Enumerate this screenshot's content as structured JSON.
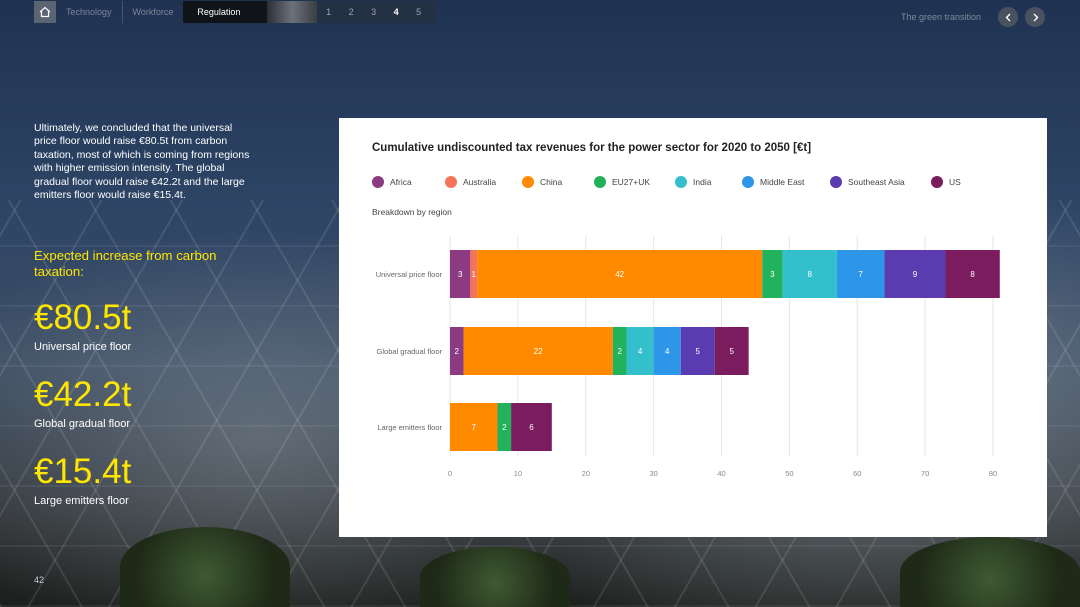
{
  "nav": {
    "tabs": [
      "Technology",
      "Workforce"
    ],
    "active_tab": "Regulation",
    "pages": [
      "1",
      "2",
      "3",
      "4",
      "5"
    ],
    "current_page": "4",
    "section_label": "The green transition",
    "icons": {
      "home": "home-icon",
      "prev": "chevron-left-icon",
      "next": "chevron-right-icon"
    }
  },
  "left": {
    "intro": "Ultimately, we concluded that the universal price floor would raise €80.5t from carbon taxation, most of which is coming from regions with higher emission intensity. The global gradual floor would raise €42.2t and the large emitters floor would raise €15.4t.",
    "expected_heading": "Expected increase from carbon taxation:",
    "stats": [
      {
        "value": "€80.5t",
        "label": "Universal price floor"
      },
      {
        "value": "€42.2t",
        "label": "Global gradual floor"
      },
      {
        "value": "€15.4t",
        "label": "Large emitters floor"
      }
    ],
    "page_number": "42"
  },
  "colors": {
    "accent": "#ffe600",
    "text": "#ffffff"
  },
  "chart_data": {
    "type": "bar",
    "orientation": "horizontal",
    "stacked": true,
    "title": "Cumulative undiscounted tax revenues for the power sector for 2020 to 2050 [€t]",
    "subtitle": "Breakdown by region",
    "categories": [
      "Universal price floor",
      "Global gradual floor",
      "Large emitters floor"
    ],
    "xlim": [
      0,
      80
    ],
    "xticks": [
      0,
      10,
      20,
      30,
      40,
      50,
      60,
      70,
      80
    ],
    "grid": true,
    "legend_position": "top",
    "series": [
      {
        "name": "Africa",
        "color": "#8c3a82",
        "values": [
          3,
          2,
          0
        ]
      },
      {
        "name": "Australia",
        "color": "#f4735a",
        "values": [
          1,
          0,
          0
        ]
      },
      {
        "name": "China",
        "color": "#ff8a00",
        "values": [
          42,
          22,
          7
        ]
      },
      {
        "name": "EU27+UK",
        "color": "#22b25c",
        "values": [
          3,
          2,
          2
        ]
      },
      {
        "name": "India",
        "color": "#33bfcb",
        "values": [
          8,
          4,
          0
        ]
      },
      {
        "name": "Middle East",
        "color": "#2d96e8",
        "values": [
          7,
          4,
          0
        ]
      },
      {
        "name": "Southeast Asia",
        "color": "#5a3bb0",
        "values": [
          9,
          5,
          0
        ]
      },
      {
        "name": "US",
        "color": "#7b1c5e",
        "values": [
          8,
          5,
          6
        ]
      }
    ]
  }
}
